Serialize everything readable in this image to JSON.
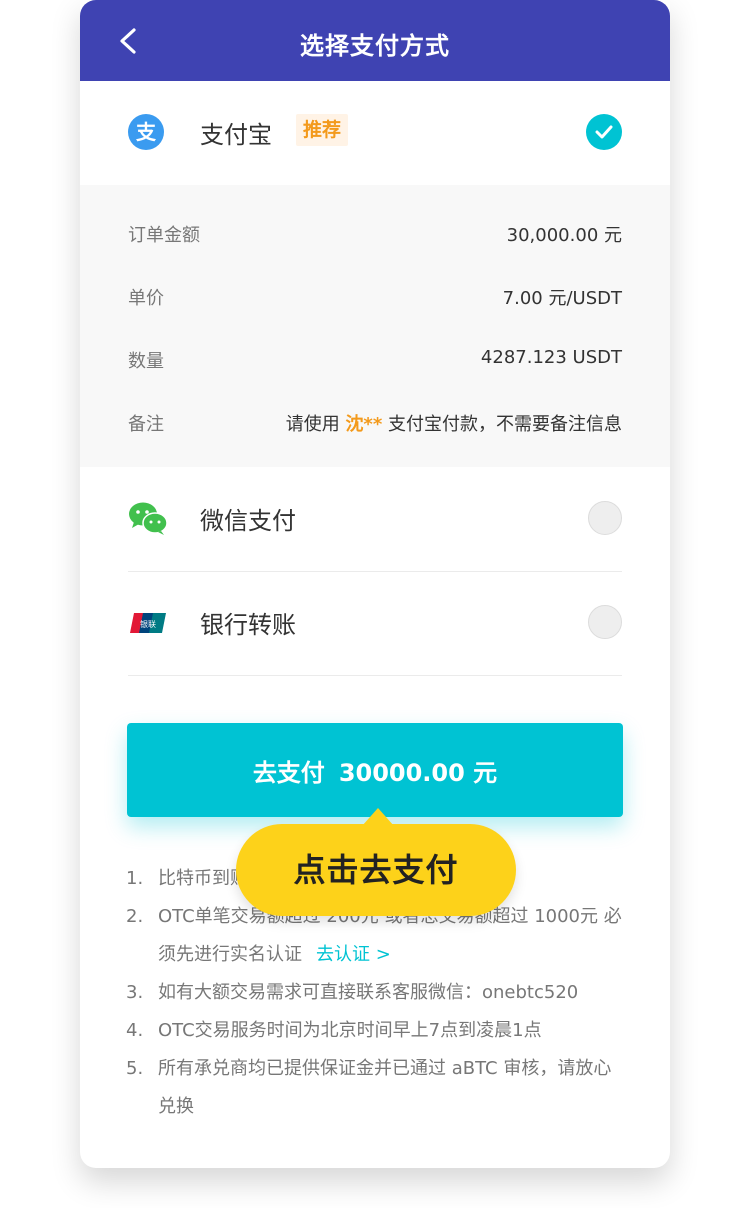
{
  "header": {
    "title": "选择支付方式",
    "back_icon": "chevron-left-icon"
  },
  "alipay": {
    "label": "支付宝",
    "tag": "推荐",
    "icon": "alipay-icon",
    "selected": true
  },
  "details": [
    {
      "key": "订单金额",
      "value": "30,000.00 元"
    },
    {
      "key": "单价",
      "value": "7.00 元/USDT"
    },
    {
      "key": "数量",
      "value": "4287.123 USDT"
    }
  ],
  "remark": {
    "key": "备注",
    "prefix": "请使用",
    "name": "沈**",
    "suffix": "支付宝付款，不需要备注信息"
  },
  "methods": [
    {
      "label": "微信支付",
      "icon": "wechat-icon",
      "selected": false
    },
    {
      "label": "银行转账",
      "icon": "unionpay-icon",
      "selected": false
    }
  ],
  "pay_button": {
    "label": "去支付",
    "amount": "30000.00 元"
  },
  "callout": "点击去支付",
  "notes": [
    {
      "num": "1.",
      "text": "比特币到账"
    },
    {
      "num": "2.",
      "text": "OTC单笔交易额超过 200元 或者总交易额超过 1000元 必须先进行实名认证",
      "link": "去认证 >"
    },
    {
      "num": "3.",
      "text": "如有大额交易需求可直接联系客服微信：onebtc520"
    },
    {
      "num": "4.",
      "text": "OTC交易服务时间为北京时间早上7点到凌晨1点"
    },
    {
      "num": "5.",
      "text": "所有承兑商均已提供保证金并已通过 aBTC 审核，请放心兑换"
    }
  ],
  "colors": {
    "header": "#3f43b2",
    "accent": "#00c3d3",
    "highlight": "#f39a1c",
    "callout": "#fdd21a"
  }
}
